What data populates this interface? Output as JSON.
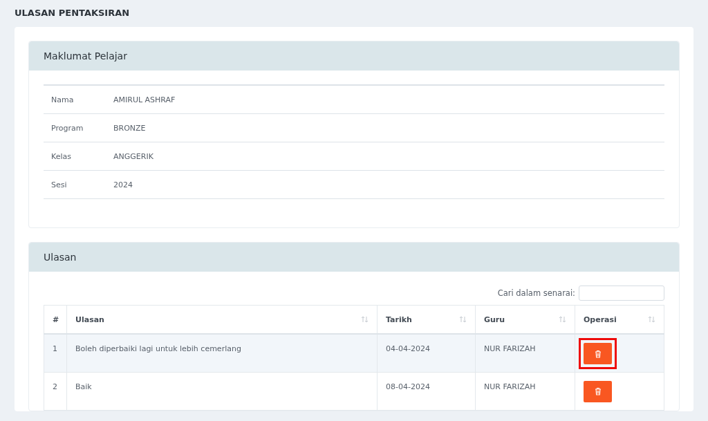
{
  "page_title": "ULASAN PENTAKSIRAN",
  "student_panel": {
    "title": "Maklumat Pelajar",
    "fields": [
      {
        "label": "Nama",
        "value": "AMIRUL ASHRAF"
      },
      {
        "label": "Program",
        "value": "BRONZE"
      },
      {
        "label": "Kelas",
        "value": "ANGGERIK"
      },
      {
        "label": "Sesi",
        "value": "2024"
      }
    ]
  },
  "review_panel": {
    "title": "Ulasan",
    "search": {
      "label": "Cari dalam senarai:"
    },
    "table": {
      "columns": [
        {
          "label": "#"
        },
        {
          "label": "Ulasan",
          "sortable": true
        },
        {
          "label": "Tarikh",
          "sortable": true
        },
        {
          "label": "Guru",
          "sortable": true
        },
        {
          "label": "Operasi",
          "sortable": true
        }
      ],
      "rows": [
        {
          "number": "1",
          "review": "Boleh diperbaiki lagi untuk lebih cemerlang",
          "date": "04-04-2024",
          "teacher": "NUR FARIZAH",
          "selected": true,
          "callout": true
        },
        {
          "number": "2",
          "review": "Baik",
          "date": "08-04-2024",
          "teacher": "NUR FARIZAH",
          "selected": false,
          "callout": false
        }
      ]
    }
  }
}
